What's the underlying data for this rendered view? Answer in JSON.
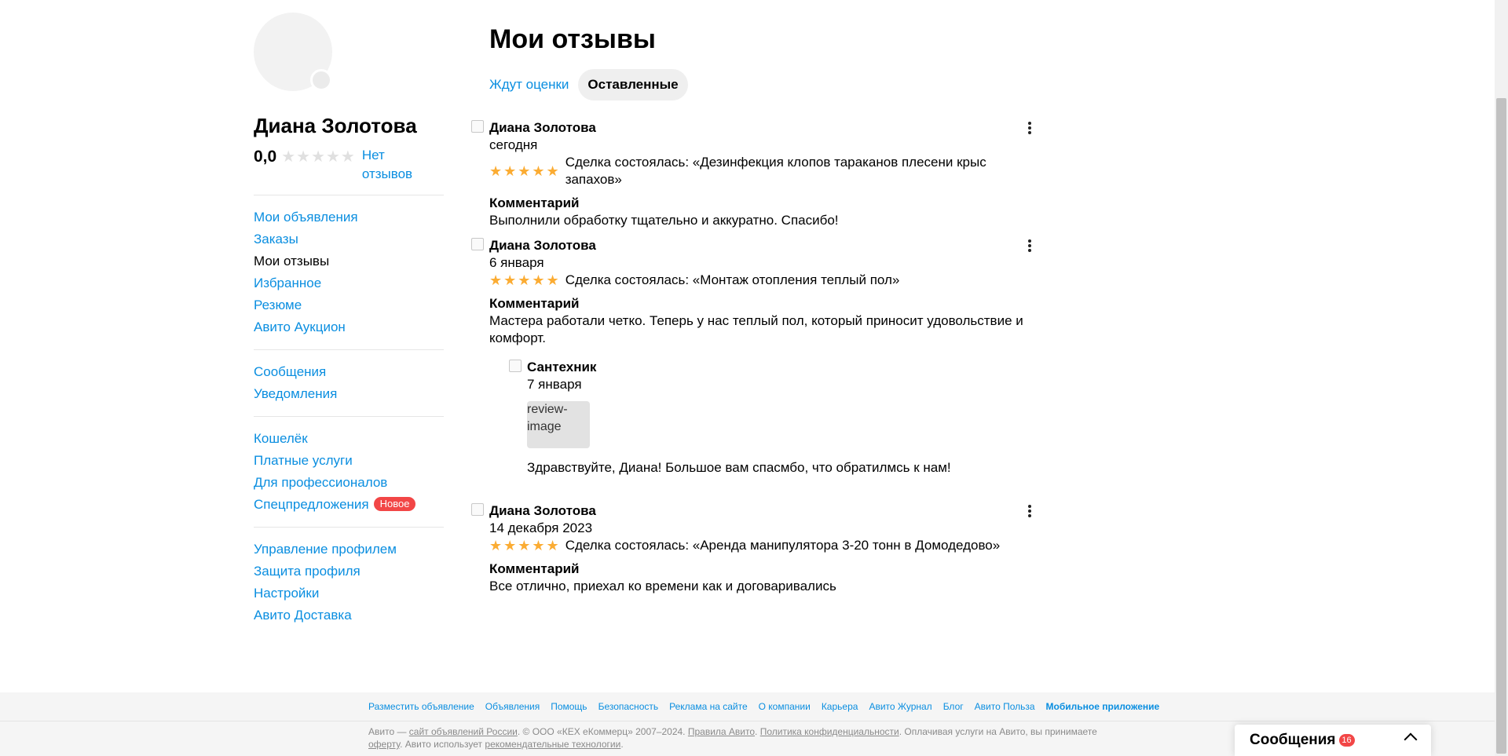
{
  "profile": {
    "name": "Диана Золотова",
    "rating_score": "0,0",
    "rating_stars": 0,
    "no_reviews": "Нет отзывов"
  },
  "sidebar": {
    "group1": [
      {
        "label": "Мои объявления",
        "active": false
      },
      {
        "label": "Заказы",
        "active": false
      },
      {
        "label": "Мои отзывы",
        "active": true
      },
      {
        "label": "Избранное",
        "active": false
      },
      {
        "label": "Резюме",
        "active": false
      },
      {
        "label": "Авито Аукцион",
        "active": false
      }
    ],
    "group2": [
      {
        "label": "Сообщения"
      },
      {
        "label": "Уведомления"
      }
    ],
    "group3": [
      {
        "label": "Кошелёк"
      },
      {
        "label": "Платные услуги"
      },
      {
        "label": "Для профессионалов"
      },
      {
        "label": "Спецпредложения",
        "badge": "Новое"
      }
    ],
    "group4": [
      {
        "label": "Управление профилем"
      },
      {
        "label": "Защита профиля"
      },
      {
        "label": "Настройки"
      },
      {
        "label": "Авито Доставка"
      }
    ]
  },
  "main": {
    "title": "Мои отзывы",
    "tabs": [
      {
        "label": "Ждут оценки",
        "active": false
      },
      {
        "label": "Оставленные",
        "active": true
      }
    ]
  },
  "reviews": [
    {
      "author": "Диана Золотова",
      "date": "сегодня",
      "stars": 5,
      "deal": "Сделка состоялась: «Дезинфекция клопов тараканов плесени крыс запахов»",
      "comment_label": "Комментарий",
      "comment": "Выполнили обработку тщательно и аккуратно. Спасибо!"
    },
    {
      "author": "Диана Золотова",
      "date": "6 января",
      "stars": 5,
      "deal": "Сделка состоялась: «Монтаж отопления теплый пол»",
      "comment_label": "Комментарий",
      "comment": "Мастера работали четко. Теперь у нас теплый пол, который приносит удовольствие и комфорт.",
      "reply": {
        "author": "Сантехник",
        "date": "7 января",
        "image_alt": "review-image",
        "text": "Здравствуйте, Диана! Большое вам спасмбо, что обратилмсь к нам!"
      }
    },
    {
      "author": "Диана Золотова",
      "date": "14 декабря 2023",
      "stars": 5,
      "deal": "Сделка состоялась: «Аренда манипулятора 3-20 тонн в Домодедово»",
      "comment_label": "Комментарий",
      "comment": "Все отлично, приехал ко времени как и договаривались"
    }
  ],
  "footer": {
    "links": [
      {
        "label": "Разместить объявление"
      },
      {
        "label": "Объявления"
      },
      {
        "label": "Помощь"
      },
      {
        "label": "Безопасность"
      },
      {
        "label": "Реклама на сайте"
      },
      {
        "label": "О компании"
      },
      {
        "label": "Карьера"
      },
      {
        "label": "Авито Журнал"
      },
      {
        "label": "Блог"
      },
      {
        "label": "Авито Польза"
      },
      {
        "label": "Мобильное приложение",
        "bold": true
      }
    ],
    "copy_1": "Авито — ",
    "copy_link_1": "сайт объявлений России",
    "copy_2": ". © ООО «КЕХ еКоммерц» 2007–2024. ",
    "copy_link_2": "Правила Авито",
    "copy_3": ". ",
    "copy_link_3": "Политика конфиденциальности",
    "copy_4": ". Оплачивая услуги на Авито, вы принимаете ",
    "copy_link_4": "оферту",
    "copy_5": ". Авито использует ",
    "copy_link_5": "рекомендательные технологии",
    "copy_6": "."
  },
  "messenger": {
    "label": "Сообщения",
    "count": "16"
  },
  "colors": {
    "link": "#0a8ee0",
    "star_active": "#fbac33",
    "star_inactive": "#e0e0e0",
    "badge": "#f24646"
  }
}
